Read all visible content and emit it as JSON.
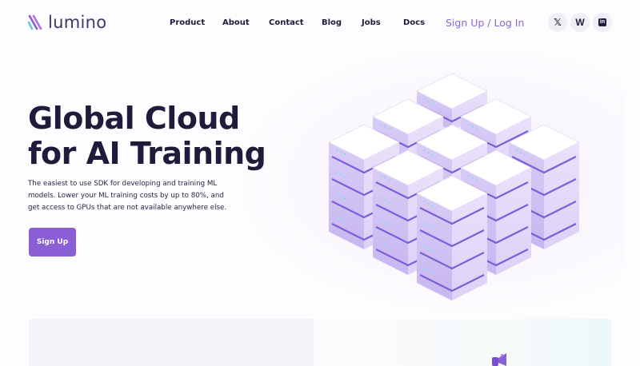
{
  "brand": {
    "name": "lumino",
    "accent": "#8a5fd6"
  },
  "nav": {
    "links": [
      "Product",
      "About",
      "Contact",
      "Blog",
      "Jobs",
      "Docs"
    ],
    "auth_label": "Sign Up / Log In"
  },
  "social": [
    {
      "name": "x-icon",
      "glyph": "𝕏"
    },
    {
      "name": "w-icon",
      "glyph": "W"
    },
    {
      "name": "linkedin-icon",
      "glyph": "in"
    }
  ],
  "hero": {
    "title_line1": "Global Cloud",
    "title_line2": "for AI Training",
    "subtitle": "The easiest to use SDK for developing and training ML models. Lower your ML training costs by up to 80%, and get access to GPUs that are not available anywhere else.",
    "cta_label": "Sign Up"
  }
}
